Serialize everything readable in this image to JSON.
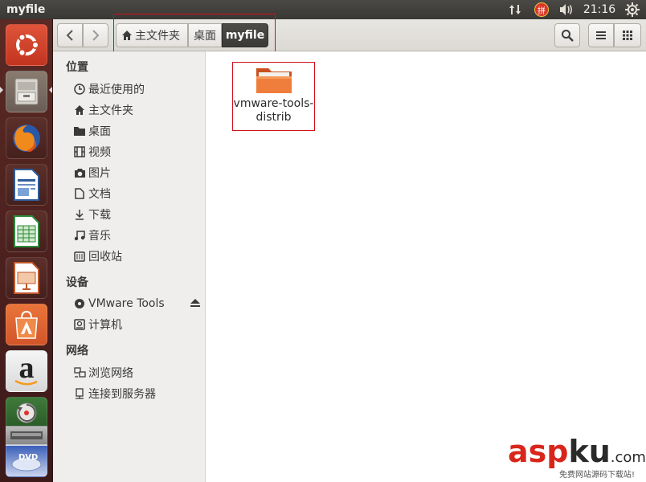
{
  "window": {
    "title": "myfile"
  },
  "panel": {
    "clock": "21:16",
    "ime": "拼"
  },
  "breadcrumbs": [
    {
      "label": "主文件夹"
    },
    {
      "label": "桌面"
    },
    {
      "label": "myfile"
    }
  ],
  "sidebar": {
    "places_heading": "位置",
    "places": [
      {
        "label": "最近使用的",
        "icon": "clock-icon"
      },
      {
        "label": "主文件夹",
        "icon": "home-icon"
      },
      {
        "label": "桌面",
        "icon": "folder-icon"
      },
      {
        "label": "视频",
        "icon": "film-icon"
      },
      {
        "label": "图片",
        "icon": "camera-icon"
      },
      {
        "label": "文档",
        "icon": "document-icon"
      },
      {
        "label": "下载",
        "icon": "download-icon"
      },
      {
        "label": "音乐",
        "icon": "music-icon"
      },
      {
        "label": "回收站",
        "icon": "trash-icon"
      }
    ],
    "devices_heading": "设备",
    "devices": [
      {
        "label": "VMware Tools",
        "icon": "disc-icon"
      },
      {
        "label": "计算机",
        "icon": "computer-icon"
      }
    ],
    "network_heading": "网络",
    "network": [
      {
        "label": "浏览网络",
        "icon": "network-icon"
      },
      {
        "label": "连接到服务器",
        "icon": "server-icon"
      }
    ]
  },
  "files": [
    {
      "name_line1": "vmware-tools-",
      "name_line2": "distrib",
      "type": "folder"
    }
  ],
  "watermark": {
    "brand_a": "asp",
    "brand_b": "ku",
    "brand_c": ".com",
    "tagline": "免费网站源码下载站!"
  },
  "colors": {
    "accent": "#dd4814",
    "highlight_box": "#d0101a",
    "launcher": "#4a1f1d"
  }
}
